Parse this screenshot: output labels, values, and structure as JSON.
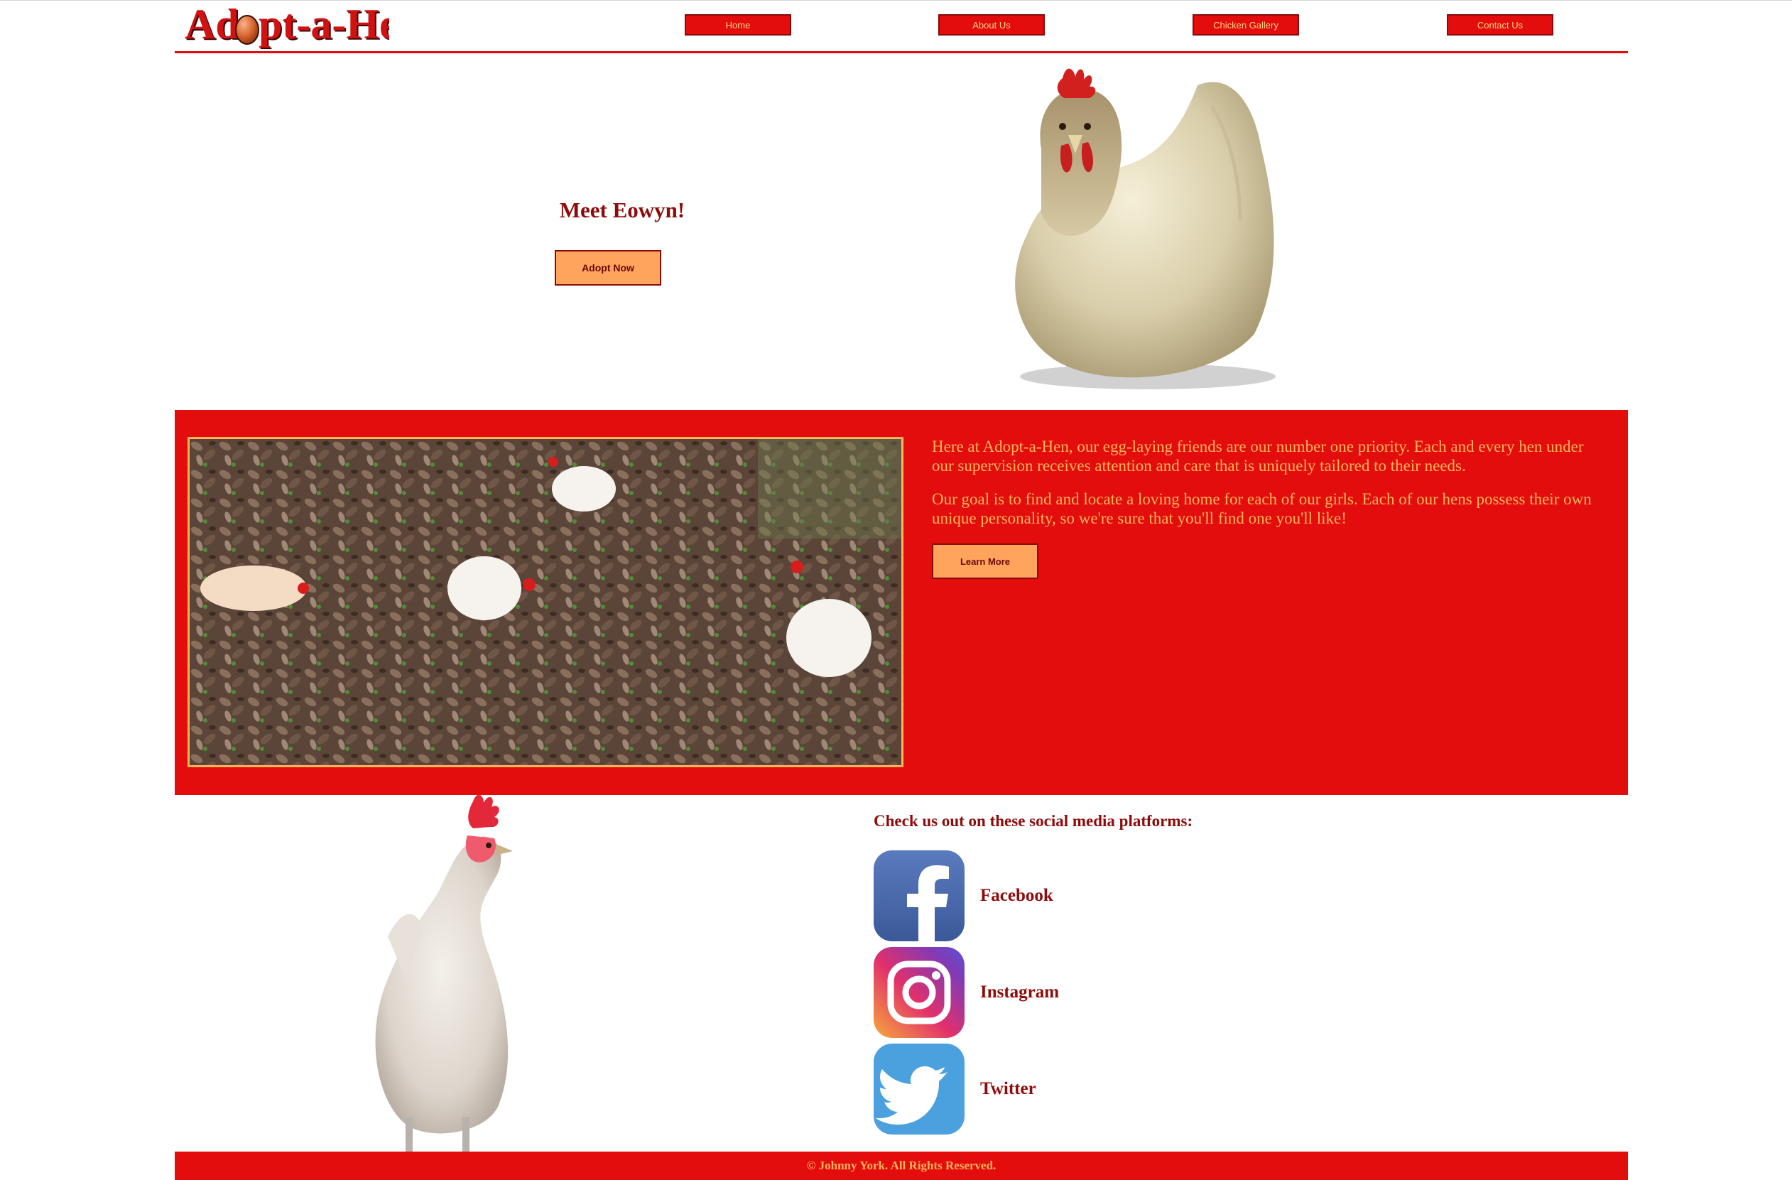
{
  "header": {
    "logo": "Adopt-a-Hen",
    "nav": [
      {
        "label": "Home"
      },
      {
        "label": "About Us"
      },
      {
        "label": "Chicken Gallery"
      },
      {
        "label": "Contact Us"
      }
    ]
  },
  "hero": {
    "title": "Meet Eowyn!",
    "button": "Adopt Now"
  },
  "about": {
    "paragraph1": "Here at Adopt-a-Hen, our egg-laying friends are our number one priority. Each and every hen under our supervision receives attention and care that is uniquely tailored to their needs.",
    "paragraph2": "Our goal is to find and locate a loving home for each of our girls. Each of our hens possess their own unique personality, so we're sure that you'll find one you'll like!",
    "button": "Learn More"
  },
  "social": {
    "heading": "Check us out on these social media platforms:",
    "items": [
      {
        "label": "Facebook",
        "icon": "facebook-icon"
      },
      {
        "label": "Instagram",
        "icon": "instagram-icon"
      },
      {
        "label": "Twitter",
        "icon": "twitter-icon"
      }
    ]
  },
  "footer": {
    "text": "© Johnny York. All Rights Reserved."
  },
  "colors": {
    "brand_red": "#e30d0d",
    "dark_red": "#8f0b0b",
    "accent_orange": "#ffa45c",
    "text_orange": "#ffb45a"
  }
}
